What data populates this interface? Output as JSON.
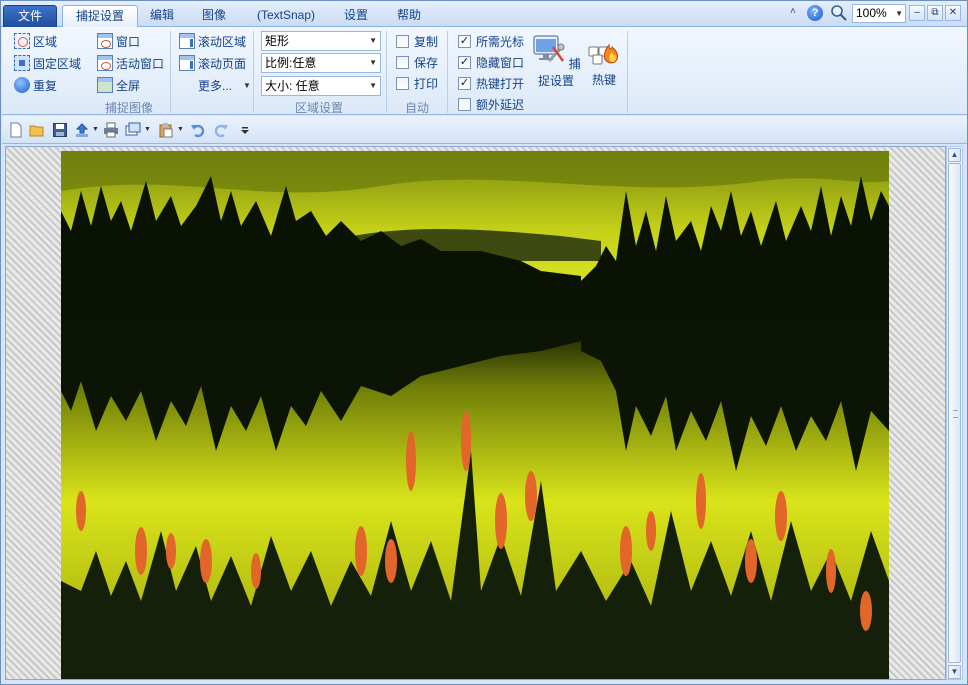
{
  "tabs": {
    "file": "文件",
    "items": [
      "捕捉设置",
      "编辑",
      "图像",
      "(TextSnap)",
      "设置",
      "帮助"
    ],
    "active_index": 0
  },
  "window_controls": {
    "zoom_value": "100%",
    "help_glyph": "?",
    "collapse_glyph": "˄",
    "minimize_glyph": "–",
    "restore_glyph": "⧉",
    "close_glyph": "✕"
  },
  "ribbon": {
    "capture_group": {
      "label": "捕捉图像",
      "col1": [
        "区域",
        "固定区域",
        "重复"
      ],
      "col2": [
        "窗口",
        "活动窗口",
        "全屏"
      ],
      "col3": [
        "滚动区域",
        "滚动页面",
        "更多..."
      ]
    },
    "region_group": {
      "label": "区域设置",
      "shape": "矩形",
      "ratio": "比例:任意",
      "size": "大小: 任意"
    },
    "auto_group": {
      "label": "自动",
      "items": [
        {
          "label": "复制",
          "checked": false
        },
        {
          "label": "保存",
          "checked": false
        },
        {
          "label": "打印",
          "checked": false
        }
      ]
    },
    "options": [
      {
        "label": "所需光标",
        "checked": true
      },
      {
        "label": "隐藏窗口",
        "checked": true
      },
      {
        "label": "热键打开",
        "checked": true
      },
      {
        "label": "额外延迟",
        "checked": false
      }
    ],
    "capture_settings": "捕捉设置",
    "hotkey": "热键"
  },
  "quick_toolbar": [
    "new-file-icon",
    "open-folder-icon",
    "save-icon",
    "upload-icon",
    "print-icon",
    "copy-window-icon",
    "paste-icon",
    "undo-icon",
    "redo-icon",
    "customize-icon"
  ],
  "colors": {
    "accent": "#15428b",
    "file_tab": "#2a5db0",
    "ribbon_bg": "#dce9f8"
  }
}
